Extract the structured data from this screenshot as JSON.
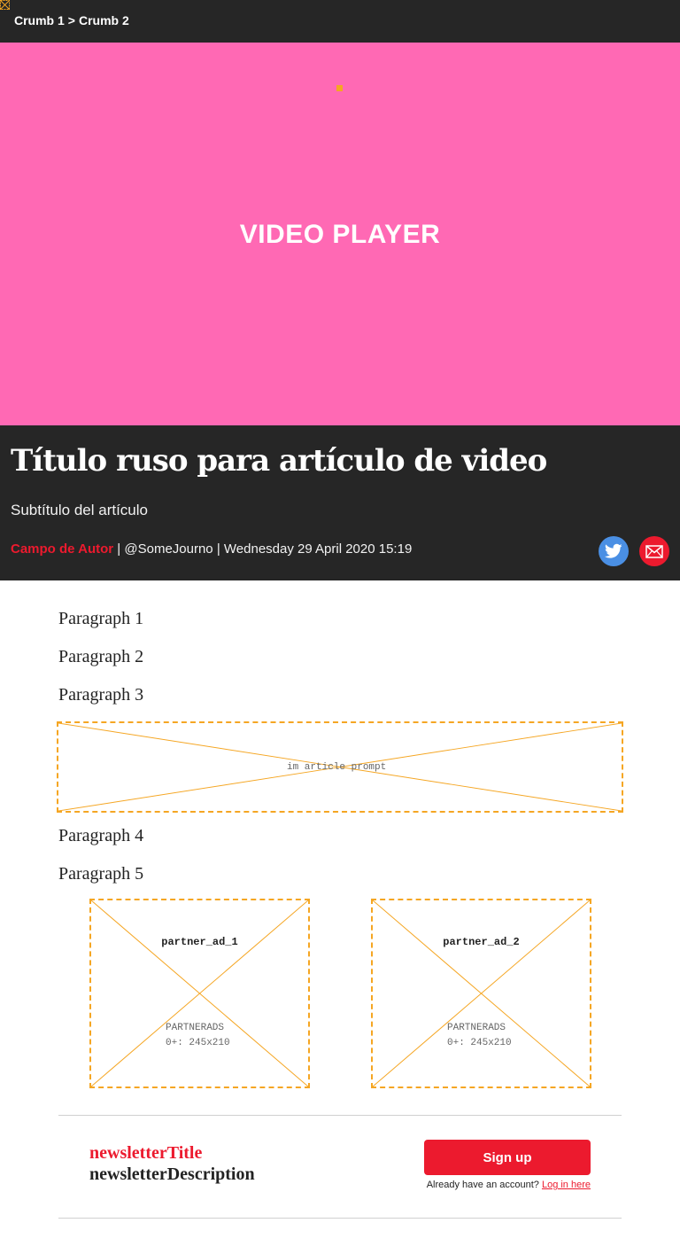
{
  "breadcrumb": {
    "items": [
      "Crumb 1",
      "Crumb 2"
    ],
    "separator": ">"
  },
  "video": {
    "label": "VIDEO PLAYER",
    "background": "#ff69b4"
  },
  "article": {
    "title": "Título ruso para artículo de video",
    "subtitle": "Subtítulo del artículo",
    "author": "Campo de Autor",
    "handle": "@SomeJourno",
    "date": "Wednesday 29 April 2020 15:19",
    "paragraphs": [
      "Paragraph 1",
      "Paragraph 2",
      "Paragraph 3",
      "Paragraph 4",
      "Paragraph 5"
    ]
  },
  "share": {
    "icons": [
      "twitter-icon",
      "email-icon"
    ],
    "twitter_color": "#4a8fe4",
    "email_color": "#ec1a2e"
  },
  "ads": {
    "article_prompt": "im article prompt",
    "partner_1": {
      "name": "partner_ad_1",
      "type": "PARTNERADS",
      "size": "0+: 245x210"
    },
    "partner_2": {
      "name": "partner_ad_2",
      "type": "PARTNERADS",
      "size": "0+: 245x210"
    }
  },
  "newsletter": {
    "title": "newsletterTitle",
    "description": "newsletterDescription",
    "signup_label": "Sign up",
    "account_prompt": "Already have an account?",
    "login_label": "Log in here"
  },
  "colors": {
    "accent": "#ec1a2e",
    "dark": "#262626",
    "placeholder": "#f5a623"
  }
}
